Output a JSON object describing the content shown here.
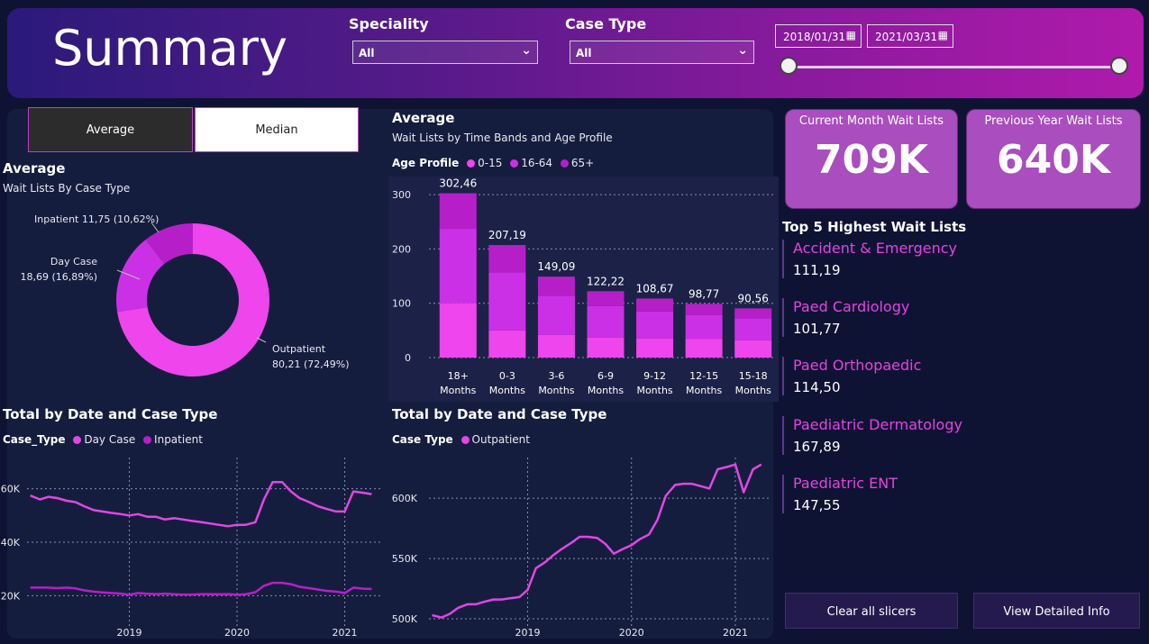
{
  "header": {
    "title": "Summary",
    "speciality_label": "Speciality",
    "speciality_value": "All",
    "case_type_label": "Case Type",
    "case_type_value": "All",
    "date_start": "2018/01/31",
    "date_end": "2021/03/31"
  },
  "toggle": {
    "average": "Average",
    "median": "Median"
  },
  "donut": {
    "title": "Average",
    "subtitle": "Wait Lists By Case Type",
    "slices": [
      {
        "name": "Outpatient",
        "value": 80.21,
        "pct": 72.49,
        "label1": "Outpatient",
        "label2": "80,21 (72,49%)",
        "color": "#ee45ec"
      },
      {
        "name": "Day Case",
        "value": 18.69,
        "pct": 16.89,
        "label1": "Day Case",
        "label2": "18,69 (16,89%)",
        "color": "#cc30e6"
      },
      {
        "name": "Inpatient",
        "value": 11.75,
        "pct": 10.62,
        "label1": "Inpatient 11,75 (10,62%)",
        "label2": "",
        "color": "#b61fc8"
      }
    ]
  },
  "bar_section": {
    "title": "Average",
    "subtitle": "Wait Lists by Time Bands and Age Profile",
    "legend_title": "Age Profile",
    "legend": [
      "0-15",
      "16-64",
      "65+"
    ]
  },
  "colors": {
    "c015": "#ee45ec",
    "c1664": "#cc30e6",
    "c65": "#b61fc8",
    "line": "#e246e4"
  },
  "line_left": {
    "title": "Total by Date and Case Type",
    "legend_title": "Case_Type",
    "legend": [
      "Day Case",
      "Inpatient"
    ]
  },
  "line_right": {
    "title": "Total by Date and Case Type",
    "legend_title": "Case Type",
    "legend": [
      "Outpatient"
    ]
  },
  "kpis": {
    "current_label": "Current Month Wait Lists",
    "current_value": "709K",
    "previous_label": "Previous Year Wait Lists",
    "previous_value": "640K"
  },
  "top5": {
    "title": "Top 5 Highest Wait Lists",
    "items": [
      {
        "name": "Accident & Emergency",
        "value": "111,19"
      },
      {
        "name": "Paed Cardiology",
        "value": "101,77"
      },
      {
        "name": "Paed Orthopaedic",
        "value": "114,50"
      },
      {
        "name": "Paediatric Dermatology",
        "value": "167,89"
      },
      {
        "name": "Paediatric ENT",
        "value": "147,55"
      }
    ]
  },
  "buttons": {
    "clear": "Clear all slicers",
    "details": "View Detailed Info"
  },
  "chart_data": [
    {
      "type": "bar",
      "title": "Average",
      "subtitle": "Wait Lists by Time Bands and Age Profile",
      "categories": [
        "18+ Months",
        "0-3 Months",
        "3-6 Months",
        "6-9 Months",
        "9-12 Months",
        "12-15 Months",
        "15-18 Months"
      ],
      "category_lines": [
        [
          "18+",
          "Months"
        ],
        [
          "0-3",
          "Months"
        ],
        [
          "3-6",
          "Months"
        ],
        [
          "6-9",
          "Months"
        ],
        [
          "9-12",
          "Months"
        ],
        [
          "12-15",
          "Months"
        ],
        [
          "15-18",
          "Months"
        ]
      ],
      "series": [
        {
          "name": "0-15",
          "values": [
            100,
            50,
            42,
            37,
            35,
            34,
            32
          ]
        },
        {
          "name": "16-64",
          "values": [
            137,
            107,
            72,
            58,
            50,
            44,
            40
          ]
        },
        {
          "name": "65+",
          "values": [
            65.46,
            50.19,
            35.09,
            27.22,
            23.67,
            20.77,
            18.56
          ]
        }
      ],
      "totals": [
        "302,46",
        "207,19",
        "149,09",
        "122,22",
        "108,67",
        "98,77",
        "90,56"
      ],
      "stacked": true,
      "ylim": [
        0,
        320
      ],
      "yticks": [
        0,
        100,
        200,
        300
      ],
      "grid": true
    },
    {
      "type": "line",
      "title": "Total by Date and Case Type",
      "xlim": [
        2018.05,
        2021.33
      ],
      "xticks": [
        2019,
        2020,
        2021
      ],
      "ylim": [
        10000,
        70000
      ],
      "yticks": [
        20000,
        40000,
        60000
      ],
      "ytick_labels": [
        "20K",
        "40K",
        "60K"
      ],
      "grid": true,
      "series": [
        {
          "name": "Day Case",
          "x": [
            2018.08,
            2018.17,
            2018.25,
            2018.33,
            2018.42,
            2018.5,
            2018.58,
            2018.67,
            2018.75,
            2018.83,
            2018.92,
            2019.0,
            2019.08,
            2019.17,
            2019.25,
            2019.33,
            2019.42,
            2019.5,
            2019.58,
            2019.67,
            2019.75,
            2019.83,
            2019.92,
            2020.0,
            2020.08,
            2020.17,
            2020.25,
            2020.33,
            2020.42,
            2020.5,
            2020.58,
            2020.67,
            2020.75,
            2020.83,
            2020.92,
            2021.0,
            2021.08,
            2021.17,
            2021.25
          ],
          "values": [
            57500,
            56000,
            57000,
            56500,
            55500,
            55000,
            53500,
            52000,
            51500,
            51000,
            50500,
            50000,
            50500,
            49500,
            49500,
            48500,
            49000,
            48500,
            48000,
            47500,
            47000,
            46500,
            46000,
            46500,
            46500,
            47500,
            56000,
            62500,
            62500,
            59000,
            56500,
            55000,
            53500,
            52500,
            51500,
            51500,
            59000,
            58500,
            58000
          ]
        },
        {
          "name": "Inpatient",
          "x": [
            2018.08,
            2018.17,
            2018.25,
            2018.33,
            2018.42,
            2018.5,
            2018.58,
            2018.67,
            2018.75,
            2018.83,
            2018.92,
            2019.0,
            2019.08,
            2019.17,
            2019.25,
            2019.33,
            2019.42,
            2019.5,
            2019.58,
            2019.67,
            2019.75,
            2019.83,
            2019.92,
            2020.0,
            2020.08,
            2020.17,
            2020.25,
            2020.33,
            2020.42,
            2020.5,
            2020.58,
            2020.67,
            2020.75,
            2020.83,
            2020.92,
            2021.0,
            2021.08,
            2021.17,
            2021.25
          ],
          "values": [
            23000,
            23000,
            23000,
            22800,
            23000,
            22700,
            22000,
            21500,
            21200,
            21000,
            20800,
            20300,
            21000,
            20700,
            20600,
            20800,
            20500,
            20400,
            20400,
            20600,
            20600,
            20500,
            20600,
            20300,
            20500,
            21300,
            23700,
            24800,
            24800,
            24300,
            23300,
            22800,
            22300,
            21800,
            21500,
            21000,
            23000,
            22600,
            22500
          ]
        }
      ]
    },
    {
      "type": "line",
      "title": "Total by Date and Case Type",
      "xlim": [
        2018.05,
        2021.33
      ],
      "xticks": [
        2019,
        2020,
        2021
      ],
      "ylim": [
        497000,
        630000
      ],
      "yticks": [
        500000,
        550000,
        600000
      ],
      "ytick_labels": [
        "500K",
        "550K",
        "600K"
      ],
      "grid": true,
      "series": [
        {
          "name": "Outpatient",
          "x": [
            2018.08,
            2018.17,
            2018.25,
            2018.33,
            2018.42,
            2018.5,
            2018.58,
            2018.67,
            2018.75,
            2018.83,
            2018.92,
            2019.0,
            2019.08,
            2019.17,
            2019.25,
            2019.33,
            2019.42,
            2019.5,
            2019.58,
            2019.67,
            2019.75,
            2019.83,
            2019.92,
            2020.0,
            2020.08,
            2020.17,
            2020.25,
            2020.33,
            2020.42,
            2020.5,
            2020.58,
            2020.67,
            2020.75,
            2020.83,
            2020.92,
            2021.0,
            2021.08,
            2021.17,
            2021.25
          ],
          "values": [
            503000,
            501000,
            504000,
            509000,
            512000,
            512000,
            514000,
            516000,
            516000,
            517000,
            518000,
            524000,
            542000,
            547000,
            553000,
            558000,
            563000,
            568000,
            568000,
            567000,
            562000,
            554000,
            558000,
            561000,
            566000,
            570000,
            582000,
            602000,
            611000,
            612000,
            612000,
            610000,
            608000,
            624000,
            626000,
            628000,
            605000,
            624000,
            628000
          ]
        }
      ]
    }
  ]
}
